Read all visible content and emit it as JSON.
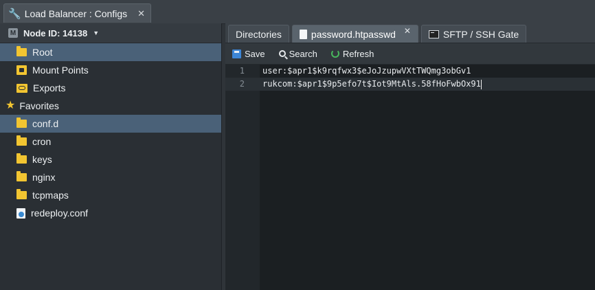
{
  "window": {
    "title": "Load Balancer : Configs",
    "close_glyph": "✕",
    "icon": "wrench-icon"
  },
  "sidebar": {
    "node_label": "Node ID: 14138",
    "node_badge": "M",
    "items": [
      {
        "label": "Root",
        "icon": "folder-icon",
        "selected": true
      },
      {
        "label": "Mount Points",
        "icon": "mount-points-icon",
        "selected": false
      },
      {
        "label": "Exports",
        "icon": "exports-icon",
        "selected": false
      }
    ],
    "favorites_label": "Favorites",
    "favorites": [
      {
        "label": "conf.d",
        "icon": "folder-icon",
        "selected": true
      },
      {
        "label": "cron",
        "icon": "folder-icon",
        "selected": false
      },
      {
        "label": "keys",
        "icon": "folder-icon",
        "selected": false
      },
      {
        "label": "nginx",
        "icon": "folder-icon",
        "selected": false
      },
      {
        "label": "tcpmaps",
        "icon": "folder-icon",
        "selected": false
      },
      {
        "label": "redeploy.conf",
        "icon": "conf-file-icon",
        "selected": false
      }
    ]
  },
  "tabs": [
    {
      "label": "Directories",
      "active": false
    },
    {
      "label": "password.htpasswd",
      "active": true,
      "close_glyph": "✕"
    },
    {
      "label": "SFTP / SSH Gate",
      "active": false
    }
  ],
  "toolbar": {
    "save_label": "Save",
    "search_label": "Search",
    "refresh_label": "Refresh"
  },
  "editor": {
    "lines": [
      {
        "number": "1",
        "text": "user:$apr1$k9rqfwx3$eJoJzupwVXtTWQmg3obGv1"
      },
      {
        "number": "2",
        "text": "rukcom:$apr1$9p5efo7t$Iot9MtAls.58fHoFwbOx91"
      }
    ]
  },
  "colors": {
    "selected_row": "#4a6178",
    "folder": "#f2c531",
    "save_blue": "#3d86d6",
    "refresh_green": "#49b85d"
  }
}
